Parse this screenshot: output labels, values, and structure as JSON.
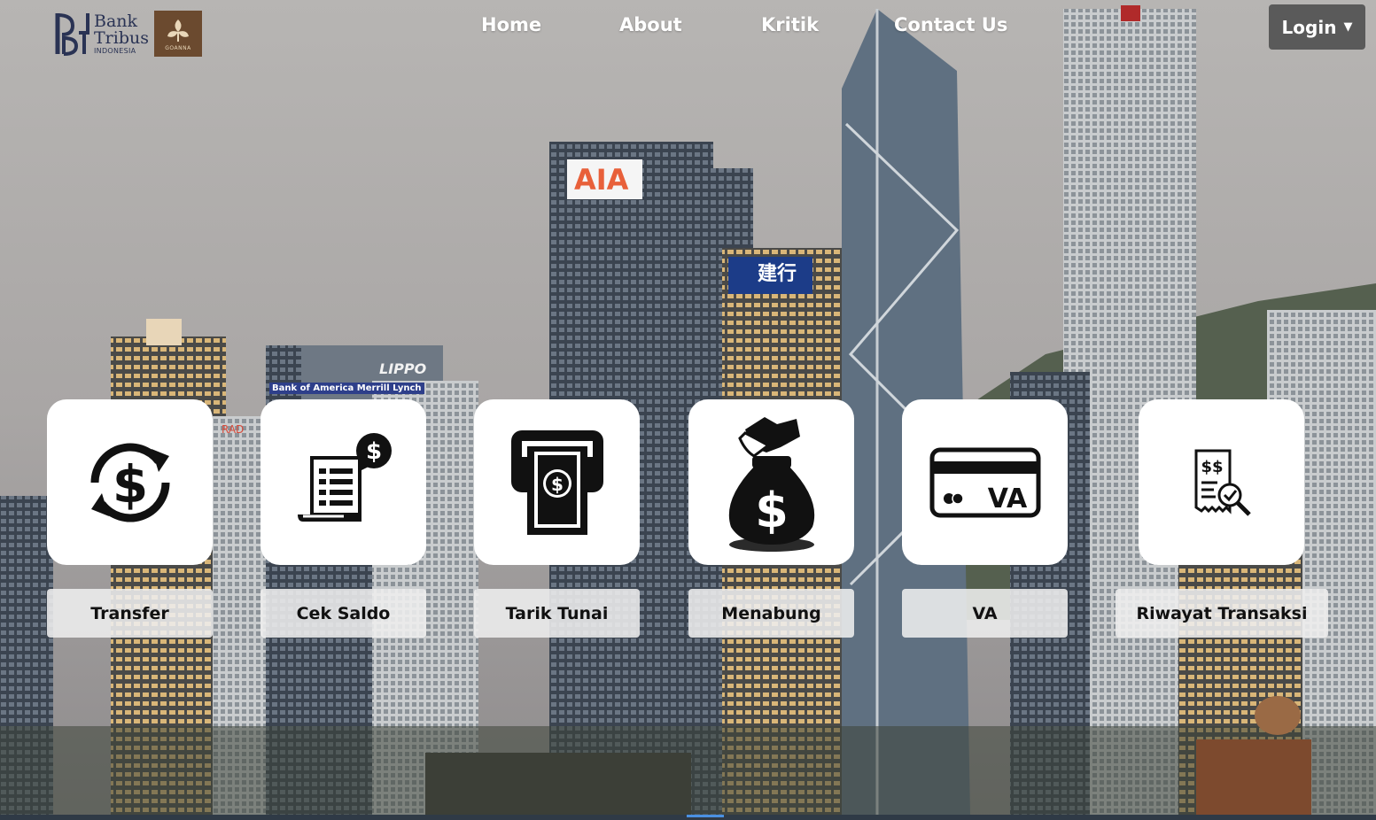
{
  "brand": {
    "line1": "Bank",
    "line2": "Tribus",
    "line3": "INDONESIA",
    "partner": "GOANNA"
  },
  "nav": {
    "items": [
      {
        "label": "Home"
      },
      {
        "label": "About"
      },
      {
        "label": "Kritik"
      },
      {
        "label": "Contact Us"
      }
    ],
    "login_label": "Login",
    "login_caret": "▼"
  },
  "billboards": {
    "aia": "AIA",
    "ccb": "建行",
    "lippo": "LIPPO",
    "boa": "Bank of America Merrill Lynch",
    "rad": "RAD"
  },
  "services": [
    {
      "label": "Transfer",
      "icon": "transfer-dollar-cycle-icon"
    },
    {
      "label": "Cek Saldo",
      "icon": "balance-receipt-icon"
    },
    {
      "label": "Tarik Tunai",
      "icon": "cash-withdrawal-icon"
    },
    {
      "label": "Menabung",
      "icon": "money-bag-icon"
    },
    {
      "label": "VA",
      "icon": "virtual-account-card-icon"
    },
    {
      "label": "Riwayat Transaksi",
      "icon": "transaction-history-icon"
    }
  ],
  "colors": {
    "nav_text": "#ffffff",
    "login_bg": "#5a5a5a",
    "tile_bg": "#ffffff",
    "label_bg": "#eeeeee"
  }
}
